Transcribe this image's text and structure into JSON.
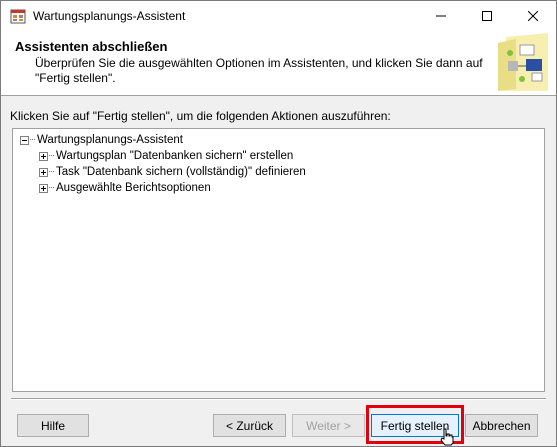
{
  "window": {
    "title": "Wartungsplanungs-Assistent",
    "controls": [
      "minimize-icon",
      "maximize-icon",
      "close-icon"
    ]
  },
  "header": {
    "title": "Assistenten abschließen",
    "description": "Überprüfen Sie die ausgewählten Optionen im Assistenten, und klicken Sie dann auf \"Fertig stellen\"."
  },
  "instruction": "Klicken Sie auf \"Fertig stellen\", um die folgenden Aktionen auszuführen:",
  "tree": {
    "root": {
      "label": "Wartungsplanungs-Assistent",
      "expanded": true
    },
    "children": [
      {
        "label": "Wartungsplan \"Datenbanken sichern\" erstellen",
        "expanded": false
      },
      {
        "label": "Task  \"Datenbank sichern (vollständig)\" definieren",
        "expanded": false
      },
      {
        "label": "Ausgewählte Berichtsoptionen",
        "expanded": false
      }
    ]
  },
  "buttons": {
    "help": "Hilfe",
    "back": "< Zurück",
    "next": "Weiter >",
    "finish": "Fertig stellen",
    "cancel": "Abbrechen"
  },
  "colors": {
    "highlight": "#e2000f",
    "focus_border": "#0078d7"
  }
}
